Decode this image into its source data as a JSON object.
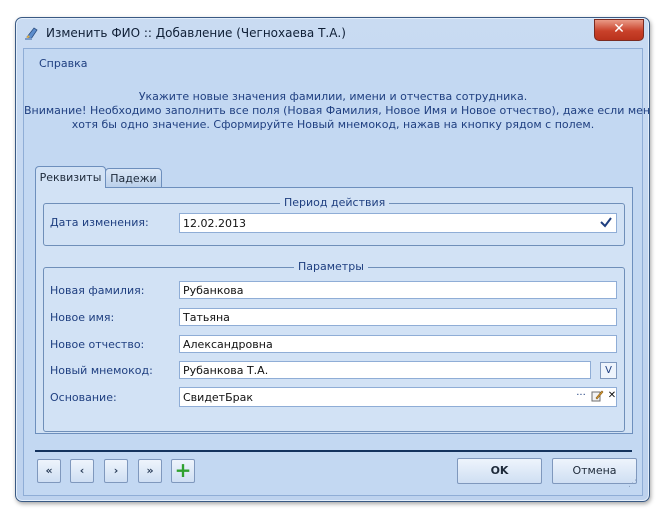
{
  "window": {
    "title": "Изменить ФИО :: Добавление  (Чегнохаева Т.А.)",
    "close_label": "✕"
  },
  "menu": {
    "help": "Справка"
  },
  "instructions": {
    "line1": "Укажите новые значения фамилии, имени и отчества сотрудника.",
    "line2": "Внимание! Необходимо заполнить все поля (Новая Фамилия, Новое Имя и Новое отчество), даже если меняется",
    "line3": "хотя бы одно значение. Сформируйте Новый мнемокод, нажав на кнопку рядом с полем."
  },
  "tabs": {
    "details": "Реквизиты",
    "cases": "Падежи"
  },
  "period_group": {
    "title": "Период действия",
    "change_date_label": "Дата изменения:",
    "change_date_value": "12.02.2013"
  },
  "params_group": {
    "title": "Параметры",
    "last_name_label": "Новая фамилия:",
    "last_name_value": "Рубанкова",
    "first_name_label": "Новое имя:",
    "first_name_value": "Татьяна",
    "middle_name_label": "Новое отчество:",
    "middle_name_value": "Александровна",
    "mnemocode_label": "Новый мнемокод:",
    "mnemocode_value": "Рубанкова Т.А.",
    "mnemocode_button": "V",
    "basis_label": "Основание:",
    "basis_value": "СвидетБрак",
    "basis_more": "···",
    "basis_clear": "✕"
  },
  "nav": {
    "first": "«",
    "prev": "‹",
    "next": "›",
    "last": "»",
    "add": "+"
  },
  "buttons": {
    "ok": "OK",
    "cancel": "Отмена"
  },
  "colors": {
    "accent": "#1f3f80",
    "add_green": "#2fa12f",
    "close_red": "#c9412a"
  }
}
